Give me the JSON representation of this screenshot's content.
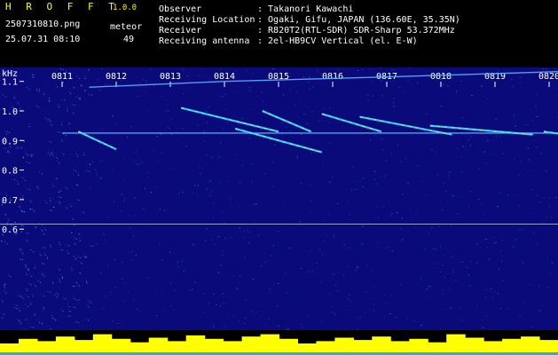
{
  "app": {
    "name": "H R O F F T",
    "version": "1.0.0"
  },
  "file": {
    "name": "2507310810.png",
    "datetime": "25.07.31 08:10"
  },
  "counter": {
    "label": "meteor",
    "value": "49"
  },
  "info": [
    {
      "key": "Observer",
      "value": ": Takanori Kawachi"
    },
    {
      "key": "Receiving Location",
      "value": ": Ogaki, Gifu, JAPAN (136.60E, 35.35N)"
    },
    {
      "key": "Receiver",
      "value": ": R820T2(RTL-SDR) SDR-Sharp 53.372MHz"
    },
    {
      "key": "Receiving antenna",
      "value": ": 2el-HB9CV Vertical (el. E-W)"
    }
  ],
  "colors": {
    "background": "#0a0a7a",
    "header_text": "#ffffff",
    "app_name": "#ffff00",
    "activity": "#ffff00"
  },
  "chart_data": {
    "type": "heatmap",
    "title": "",
    "xlabel": "",
    "ylabel": "kHz",
    "x_ticks": [
      "0811",
      "0812",
      "0813",
      "0814",
      "0815",
      "0816",
      "0817",
      "0818",
      "0819",
      "0820"
    ],
    "y_ticks": [
      "1.1",
      "1.0",
      "0.9",
      "0.8",
      "0.7",
      "0.6"
    ],
    "ylim": [
      0.58,
      1.16
    ],
    "traces": [
      {
        "kind": "carrier",
        "points": [
          [
            0.5,
            1.08
          ],
          [
            3,
            1.1
          ],
          [
            6,
            1.115
          ],
          [
            9.5,
            1.135
          ]
        ]
      },
      {
        "kind": "carrier",
        "points": [
          [
            0,
            0.925
          ],
          [
            9.8,
            0.925
          ]
        ]
      },
      {
        "kind": "meteor",
        "points": [
          [
            0.3,
            0.93
          ],
          [
            1.0,
            0.87
          ]
        ]
      },
      {
        "kind": "meteor",
        "points": [
          [
            2.2,
            1.01
          ],
          [
            4.0,
            0.93
          ]
        ]
      },
      {
        "kind": "meteor",
        "points": [
          [
            3.2,
            0.94
          ],
          [
            4.8,
            0.86
          ]
        ]
      },
      {
        "kind": "meteor",
        "points": [
          [
            3.7,
            1.0
          ],
          [
            4.6,
            0.93
          ]
        ]
      },
      {
        "kind": "meteor",
        "points": [
          [
            4.8,
            0.99
          ],
          [
            5.9,
            0.93
          ]
        ]
      },
      {
        "kind": "meteor",
        "points": [
          [
            5.5,
            0.98
          ],
          [
            7.2,
            0.92
          ]
        ]
      },
      {
        "kind": "meteor",
        "points": [
          [
            6.8,
            0.95
          ],
          [
            8.7,
            0.92
          ]
        ]
      },
      {
        "kind": "meteor",
        "points": [
          [
            8.9,
            0.93
          ],
          [
            9.7,
            0.91
          ]
        ]
      }
    ],
    "activity_levels": [
      0.5,
      0.7,
      0.6,
      0.8,
      0.65,
      0.9,
      0.7,
      0.55,
      0.75,
      0.6,
      0.85,
      0.7,
      0.6,
      0.8,
      0.9,
      0.7,
      0.5,
      0.6,
      0.75,
      0.65,
      0.8,
      0.6,
      0.7,
      0.55,
      0.9,
      0.75,
      0.6,
      0.7,
      0.8,
      0.65
    ]
  }
}
